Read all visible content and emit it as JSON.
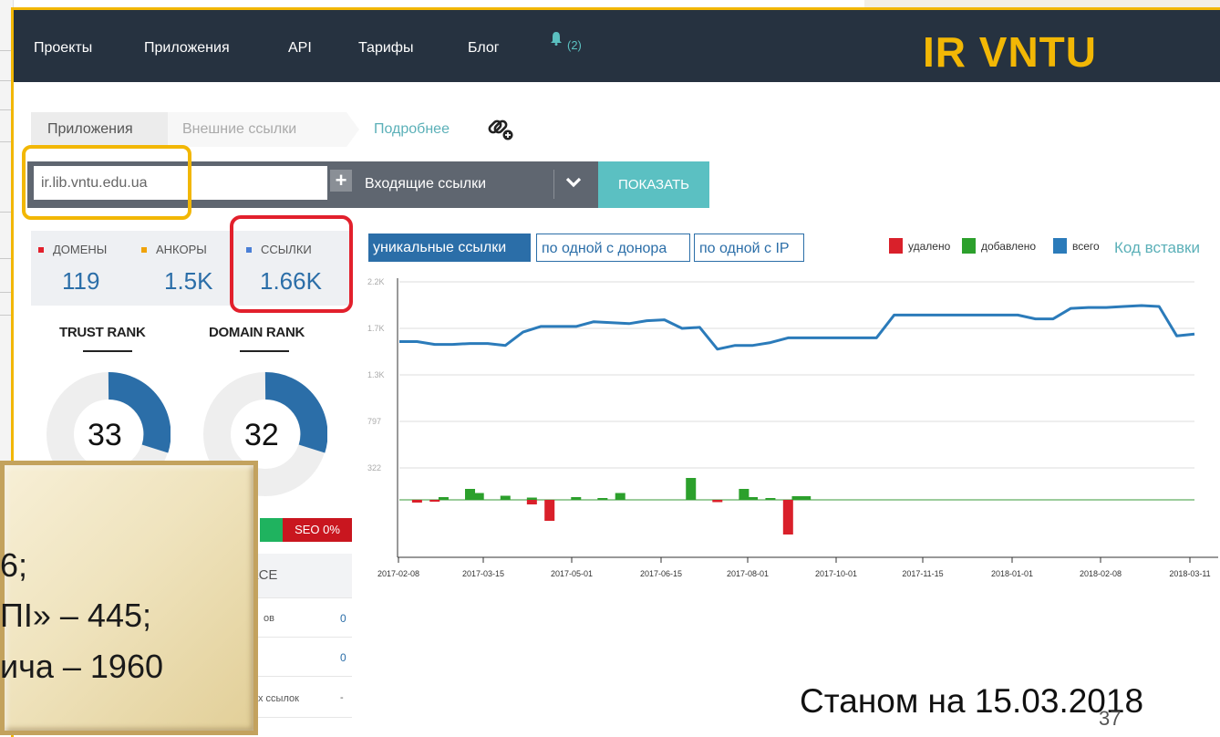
{
  "nav": {
    "items": [
      "Проекты",
      "Приложения",
      "API",
      "Тарифы",
      "Блог"
    ],
    "notifications": "(2)",
    "brand": "IR VNTU"
  },
  "breadcrumb": {
    "step1": "Приложения",
    "step2": "Внешние ссылки",
    "more": "Подробнее"
  },
  "search": {
    "value": "ir.lib.vntu.edu.ua",
    "select_value": "Входящие ссылки",
    "submit_label": "ПОКАЗАТЬ"
  },
  "stats": {
    "domains_label": "ДОМЕНЫ",
    "domains_value": "119",
    "anchors_label": "АНКОРЫ",
    "anchors_value": "1.5K",
    "links_label": "ССЫЛКИ",
    "links_value": "1.66K",
    "colors": {
      "domains": "#e2202c",
      "anchors": "#f0a30a",
      "links": "#4a7fd6"
    }
  },
  "ranks": {
    "trust_title": "TRUST RANK",
    "trust_value": "33",
    "domain_title": "DOMAIN RANK",
    "domain_value": "32"
  },
  "seo": {
    "label": "SEO 0%",
    "table_header": "КСЕ",
    "rows": [
      {
        "label": "ов",
        "value": "0"
      },
      {
        "label": "",
        "value": "0"
      },
      {
        "label": "х ссылок",
        "value": "-"
      }
    ]
  },
  "overlay": {
    "lines": [
      "6;",
      "ПІ» – 445;",
      "ича – 1960"
    ]
  },
  "chart_tabs": [
    "уникальные ссылки",
    "по одной с донора",
    "по одной с IP"
  ],
  "legend": {
    "removed": "удалено",
    "added": "добавлено",
    "total": "всего",
    "colors": {
      "removed": "#d9202a",
      "added": "#2ca02c",
      "total": "#2b7bba"
    },
    "embed_code": "Код вставки"
  },
  "chart_data": {
    "type": "line",
    "yticks": [
      "2.2K",
      "1.7K",
      "1.3K",
      "797",
      "322"
    ],
    "ytick_values": [
      2200,
      1700,
      1300,
      797,
      322
    ],
    "xticks": [
      "2017-02-08",
      "2017-03-15",
      "2017-05-01",
      "2017-06-15",
      "2017-08-01",
      "2017-10-01",
      "2017-11-15",
      "2018-01-01",
      "2018-02-08",
      "2018-03-11"
    ],
    "series": [
      {
        "name": "всего",
        "x": [
          0,
          2,
          4,
          6,
          8,
          10,
          12,
          14,
          16,
          18,
          20,
          22,
          24,
          26,
          28,
          30,
          32,
          34,
          36,
          38,
          40,
          42,
          44,
          46,
          48,
          50,
          52,
          54,
          56,
          58,
          60,
          62,
          64,
          66,
          68,
          70,
          72,
          74,
          76,
          78,
          80,
          82,
          84,
          86,
          88,
          90
        ],
        "values": [
          1570,
          1570,
          1540,
          1540,
          1550,
          1550,
          1530,
          1670,
          1730,
          1730,
          1730,
          1780,
          1770,
          1760,
          1790,
          1800,
          1710,
          1720,
          1490,
          1530,
          1530,
          1560,
          1610,
          1610,
          1610,
          1610,
          1610,
          1610,
          1850,
          1850,
          1850,
          1850,
          1850,
          1850,
          1850,
          1850,
          1810,
          1810,
          1920,
          1930,
          1930,
          1940,
          1950,
          1940,
          1630,
          1650
        ]
      }
    ],
    "added_bars": [
      {
        "x": 5,
        "value": 30
      },
      {
        "x": 8,
        "value": 120
      },
      {
        "x": 9,
        "value": 75
      },
      {
        "x": 12,
        "value": 45
      },
      {
        "x": 15,
        "value": 25
      },
      {
        "x": 20,
        "value": 30
      },
      {
        "x": 23,
        "value": 20
      },
      {
        "x": 25,
        "value": 75
      },
      {
        "x": 33,
        "value": 240
      },
      {
        "x": 39,
        "value": 120
      },
      {
        "x": 40,
        "value": 30
      },
      {
        "x": 42,
        "value": 20
      },
      {
        "x": 45,
        "value": 40
      },
      {
        "x": 46,
        "value": 40
      }
    ],
    "removed_bars": [
      {
        "x": 2,
        "value": 30
      },
      {
        "x": 4,
        "value": 20
      },
      {
        "x": 15,
        "value": 50
      },
      {
        "x": 17,
        "value": 230
      },
      {
        "x": 36,
        "value": 25
      },
      {
        "x": 44,
        "value": 380
      }
    ]
  },
  "footer": {
    "date": "Станом на 15.03.2018",
    "page": "37"
  }
}
